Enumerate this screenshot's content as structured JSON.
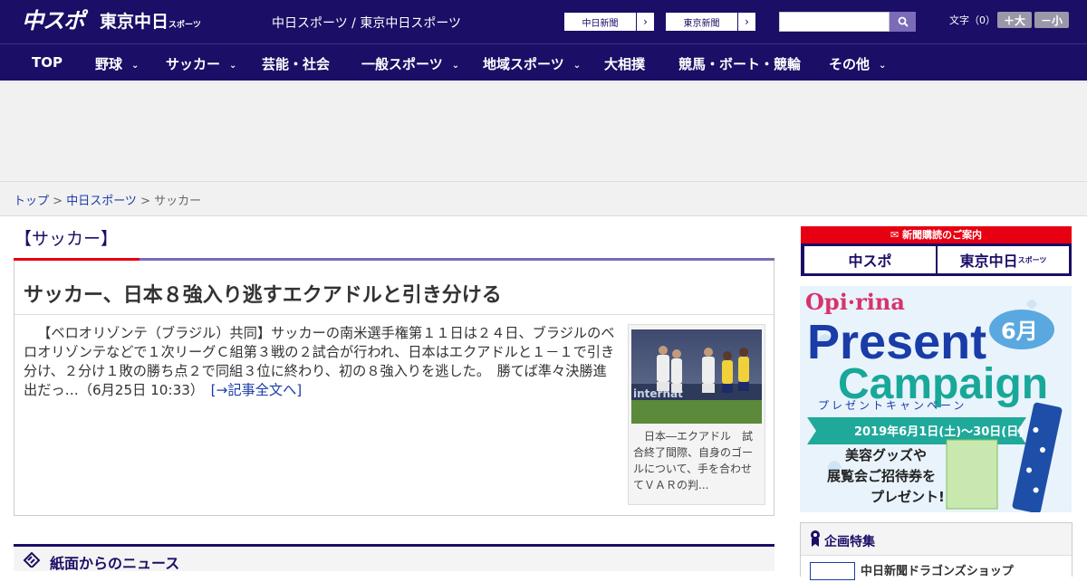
{
  "header": {
    "logo_chunichi": "中スポ",
    "logo_tokyo": "東京中日",
    "logo_tokyo_sub": "スポーツ",
    "tagline": "中日スポーツ / 東京中日スポーツ",
    "paper_buttons": [
      {
        "label": "中日新聞"
      },
      {
        "label": "東京新聞"
      }
    ],
    "font_size_label": "文字（0）",
    "font_larger": "＋大",
    "font_smaller": "－小",
    "search_placeholder": ""
  },
  "nav": {
    "items": [
      {
        "label": "TOP",
        "dropdown": false
      },
      {
        "label": "野球",
        "dropdown": true
      },
      {
        "label": "サッカー",
        "dropdown": true
      },
      {
        "label": "芸能・社会",
        "dropdown": false
      },
      {
        "label": "一般スポーツ",
        "dropdown": true
      },
      {
        "label": "地域スポーツ",
        "dropdown": true
      },
      {
        "label": "大相撲",
        "dropdown": false
      },
      {
        "label": "競馬・ボート・競輪",
        "dropdown": false
      },
      {
        "label": "その他",
        "dropdown": true
      }
    ]
  },
  "breadcrumb": {
    "items": [
      "トップ",
      "中日スポーツ"
    ],
    "current": "サッカー",
    "separator": " > "
  },
  "category_heading": "【サッカー】",
  "article": {
    "title": "サッカー、日本８強入り逃すエクアドルと引き分ける",
    "body": "【ベロオリゾンテ（ブラジル）共同】サッカーの南米選手権第１１日は２４日、ブラジルのベロオリゾンテなどで１次リーグＣ組第３戦の２試合が行われ、日本はエクアドルと１－１で引き分け、２分け１敗の勝ち点２で同組３位に終わり、初の８強入りを逃した。　勝てば準々決勝進出だっ…（6月25日 10:33）　",
    "read_more": "[→記事全文へ]",
    "photo_caption": "日本―エクアドル　試合終了間際、自身のゴールについて、手を合わせてＶＡＲの判..."
  },
  "newspaper_section": {
    "label": "紙面からのニュース"
  },
  "subscription": {
    "header": "新聞購読のご案内",
    "left": "中スポ",
    "right": "東京中日",
    "right_sub": "スポーツ"
  },
  "banner": {
    "brand": "Opi·rina",
    "line1": "Present",
    "line2": "Campaign",
    "kana": "プレゼントキャンペーン",
    "month": "6月",
    "dates": "2019年6月1日(土)〜30日(日)",
    "promo1": "美容グッズや",
    "promo2": "展覧会ご招待券を",
    "promo3": "プレゼント!"
  },
  "feature": {
    "label": "企画特集",
    "item": "中日新聞ドラゴンズショップ"
  },
  "colors": {
    "navy": "#1a0e66",
    "red": "#e60012",
    "purple": "#7b6bb8",
    "link": "#1a3ca8"
  }
}
